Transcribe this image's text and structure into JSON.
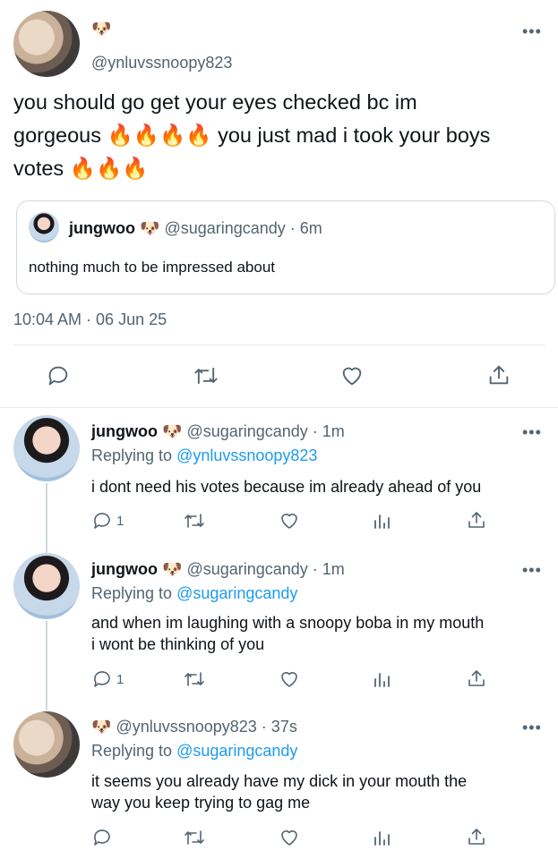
{
  "main_tweet": {
    "name_emoji": "🐶",
    "handle": "@ynluvssnoopy823",
    "text_lines": [
      "you should go get your eyes checked bc im",
      "gorgeous 🔥🔥🔥🔥 you just mad i took your boys",
      "votes 🔥🔥🔥"
    ],
    "quote": {
      "name": "jungwoo",
      "emoji": "🐶",
      "handle_time": "@sugaringcandy · 6m",
      "text": "nothing much to be impressed about"
    },
    "timestamp": "10:04 AM · 06 Jun 25"
  },
  "replies": [
    {
      "name": "jungwoo",
      "emoji": "🐶",
      "handle_time": "@sugaringcandy · 1m",
      "replying_prefix": "Replying to ",
      "replying_to": "@ynluvssnoopy823",
      "text_lines": [
        "i dont need his votes because im already ahead of you"
      ],
      "reply_count": "1"
    },
    {
      "name": "jungwoo",
      "emoji": "🐶",
      "handle_time": "@sugaringcandy · 1m",
      "replying_prefix": "Replying to ",
      "replying_to": "@sugaringcandy",
      "text_lines": [
        "and when im laughing with a snoopy boba in my mouth",
        "i wont be thinking of you"
      ],
      "reply_count": "1"
    },
    {
      "name": "",
      "emoji": "🐶",
      "handle_time": "@ynluvssnoopy823 · 37s",
      "replying_prefix": "Replying to ",
      "replying_to": "@sugaringcandy",
      "text_lines": [
        "it seems you already have my dick in your mouth the",
        "way you keep trying to gag me"
      ],
      "reply_count": ""
    }
  ],
  "icons": [
    "reply-icon",
    "retweet-icon",
    "like-icon",
    "analytics-icon",
    "share-icon",
    "more-icon"
  ],
  "colors": {
    "link": "#1d9bf0",
    "secondary": "#536471",
    "text": "#0f1419"
  }
}
